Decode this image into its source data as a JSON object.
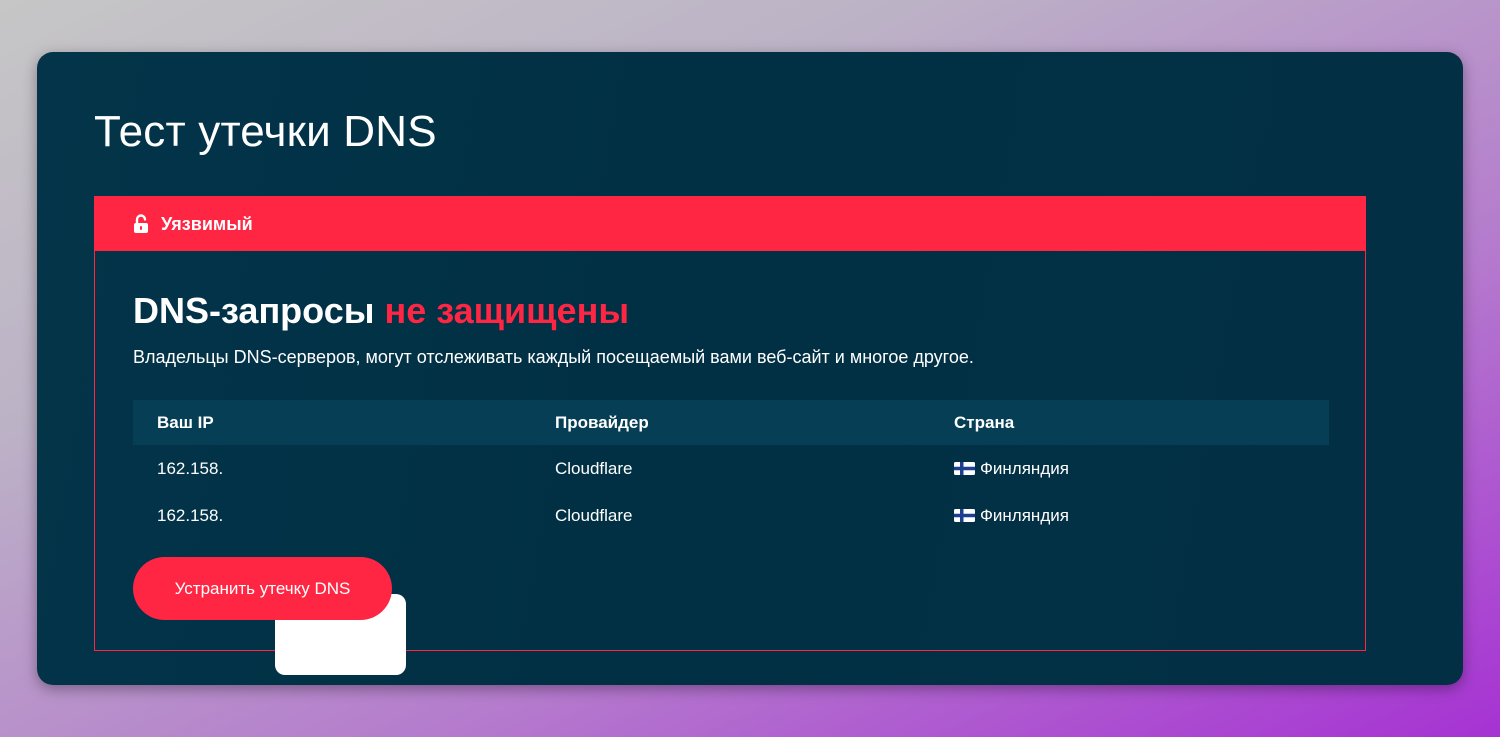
{
  "page": {
    "title": "Тест утечки DNS"
  },
  "status": {
    "label": "Уязвимый",
    "icon": "unlock-icon",
    "color": "#ff2643"
  },
  "headline": {
    "prefix": "DNS-запросы ",
    "highlight": "не защищены"
  },
  "description": "Владельцы DNS-серверов, могут отслеживать каждый посещаемый вами веб-сайт и многое другое.",
  "table": {
    "columns": [
      "Ваш IP",
      "Провайдер",
      "Страна"
    ],
    "rows": [
      {
        "ip": "162.158.",
        "provider": "Cloudflare",
        "country": "Финляндия",
        "flag": "finland-flag-icon"
      },
      {
        "ip": "162.158.",
        "provider": "Cloudflare",
        "country": "Финляндия",
        "flag": "finland-flag-icon"
      }
    ]
  },
  "action": {
    "button_label": "Устранить утечку DNS"
  },
  "colors": {
    "accent": "#ff2643",
    "card_background": "#01344a",
    "table_header": "#063e55"
  }
}
